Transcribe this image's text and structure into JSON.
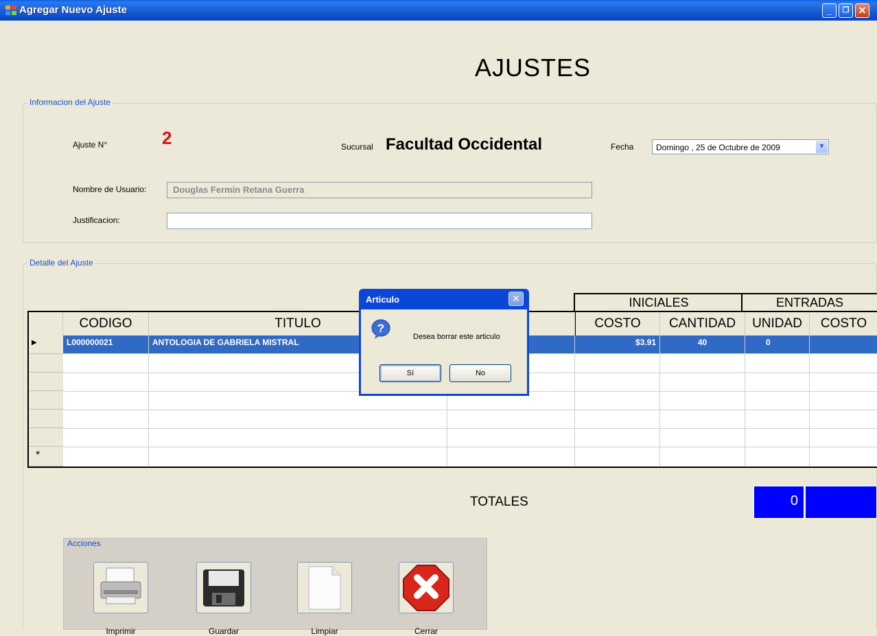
{
  "window": {
    "title": "Agregar Nuevo Ajuste"
  },
  "heading": "AJUSTES",
  "info": {
    "legend": "Informacion del Ajuste",
    "ajuste_label": "Ajuste N°",
    "ajuste_value": "2",
    "sucursal_label": "Sucursal",
    "sucursal_value": "Facultad Occidental",
    "fecha_label": "Fecha",
    "fecha_value": "Domingo , 25 de  Octubre  de 2009",
    "usuario_label": "Nombre de Usuario:",
    "usuario_value": "Douglas Fermin Retana Guerra",
    "justificacion_label": "Justificacion:",
    "justificacion_value": ""
  },
  "detalle": {
    "legend": "Detalle del Ajuste",
    "group_headers": [
      "INICIALES",
      "ENTRADAS"
    ],
    "columns": [
      "CODIGO",
      "TITULO",
      "COSTO",
      "CANTIDAD",
      "UNIDAD",
      "COSTO"
    ],
    "rows": [
      {
        "codigo": "L000000021",
        "titulo": "ANTOLOGIA DE GABRIELA MISTRAL",
        "costo": "$3.91",
        "cantidad": "40",
        "unidad": "0",
        "costo2": ""
      }
    ],
    "new_row_marker": "*"
  },
  "totales": {
    "label": "TOTALES",
    "value": "0"
  },
  "acciones": {
    "legend": "Acciones",
    "buttons": [
      "Imprimir",
      "Guardar",
      "Limpiar",
      "Cerrar"
    ]
  },
  "dialog": {
    "title": "Articulo",
    "message": "Desea borrar este articulo",
    "yes": "Sí",
    "no": "No"
  },
  "colors": {
    "accent": "#0A46D8",
    "selected_row": "#316AC5",
    "totals_box": "#0000FF",
    "ajuste_number": "#E01010"
  }
}
